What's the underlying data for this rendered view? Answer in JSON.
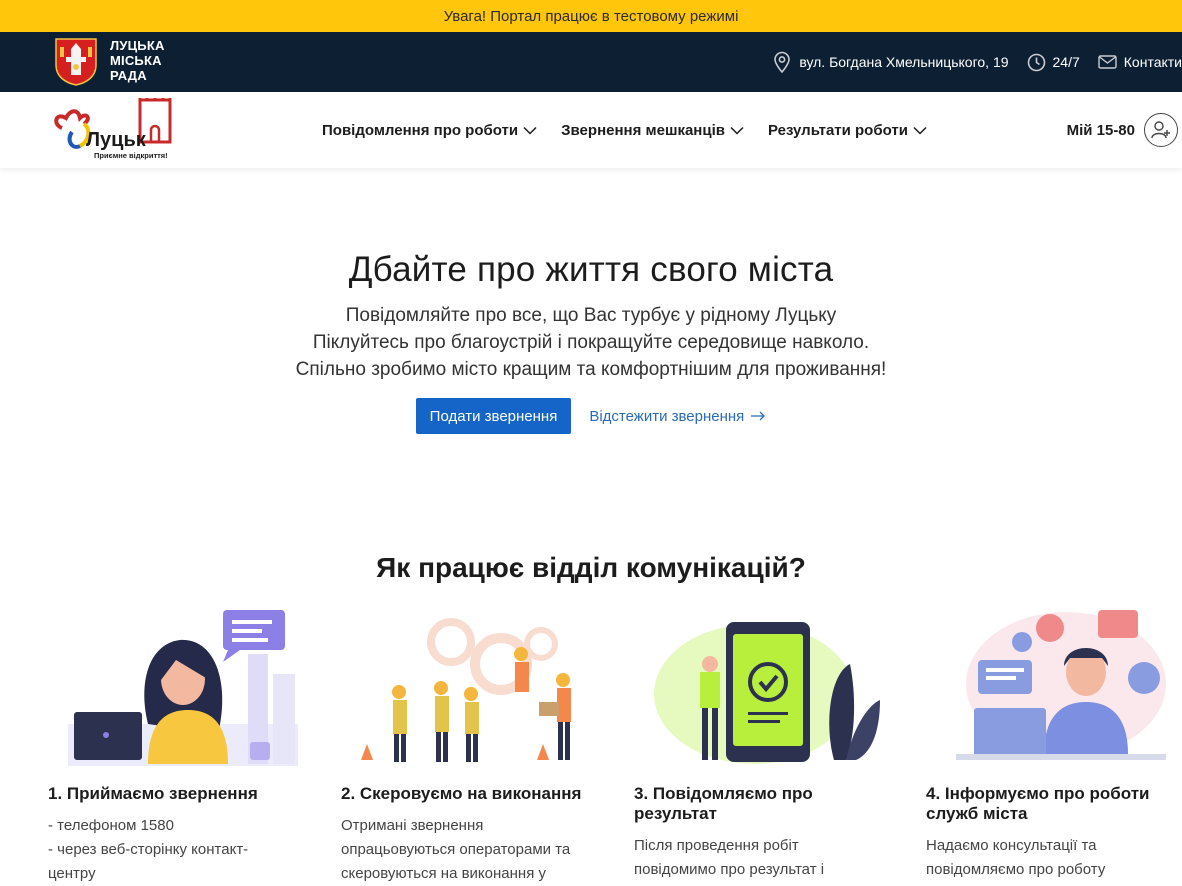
{
  "alert": {
    "text": "Увага! Портал працює в тестовому режимі"
  },
  "topbar": {
    "council_lines": [
      "ЛУЦЬКА",
      "МІСЬКА",
      "РАДА"
    ],
    "address": "вул. Богдана Хмельницького, 19",
    "hours": "24/7",
    "contacts": "Контакти",
    "icons": {
      "address": "map-pin-icon",
      "hours": "clock-icon",
      "contacts": "mail-icon"
    }
  },
  "navbar": {
    "logo_text": "Луцьк",
    "logo_slogan": "Приємне відкриття!",
    "menu": [
      {
        "label": "Повідомлення про роботи"
      },
      {
        "label": "Звернення мешканців"
      },
      {
        "label": "Результати роботи"
      }
    ],
    "account_label": "Мій 15-80"
  },
  "hero": {
    "title": "Дбайте про життя свого міста",
    "lines": [
      "Повідомляйте про все, що Вас турбує у рідному Луцьку",
      "Піклуйтесь про благоустрій і покращуйте середовище навколо.",
      "Спільно зробимо місто кращим та комфортнішим для проживання!"
    ],
    "primary_button": "Подати звернення",
    "secondary_link": "Відстежити звернення"
  },
  "how": {
    "title": "Як працює відділ комунікацій?",
    "cards": [
      {
        "title": "1. Приймаємо звернення",
        "text": [
          "- телефоном 1580",
          "- через веб-сторінку контакт-",
          "центру"
        ]
      },
      {
        "title": "2. Скеровуємо на виконання",
        "text": [
          "Отримані звернення",
          "опрацьовуються операторами та",
          "скеровуються на виконання у"
        ]
      },
      {
        "title": "3. Повідомляємо про результат",
        "text": [
          "Після проведення робіт",
          "повідомимо про результат і"
        ]
      },
      {
        "title": "4. Інформуємо про роботи служб міста",
        "text": [
          "Надаємо консультації та",
          "повідомляємо про роботу"
        ]
      }
    ]
  },
  "colors": {
    "alert": "#ffc60b",
    "topbar": "#0d2033",
    "primary": "#1565c8",
    "link": "#2a6bb5"
  }
}
